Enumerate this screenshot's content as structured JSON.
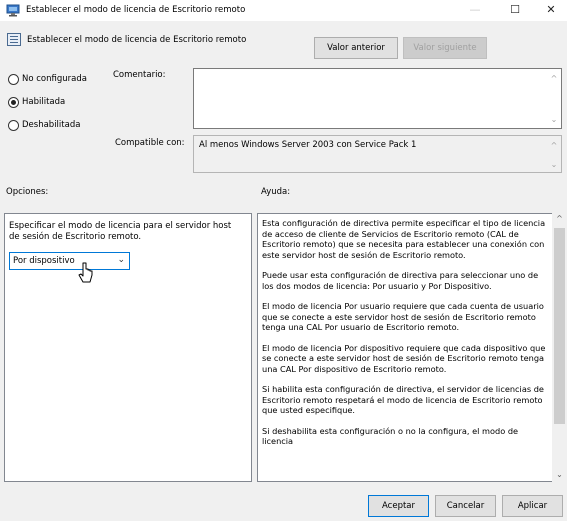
{
  "window": {
    "title": "Establecer el modo de licencia de Escritorio remoto",
    "minimize": "—",
    "maximize": "☐",
    "close": "✕"
  },
  "header": {
    "policy_title": "Establecer el modo de licencia de Escritorio remoto",
    "prev_button": "Valor anterior",
    "next_button": "Valor siguiente"
  },
  "state": {
    "options": [
      {
        "label": "No configurada",
        "checked": false
      },
      {
        "label": "Habilitada",
        "checked": true
      },
      {
        "label": "Deshabilitada",
        "checked": false
      }
    ]
  },
  "comment": {
    "label": "Comentario:",
    "value": ""
  },
  "supported": {
    "label": "Compatible con:",
    "value": "Al menos Windows Server 2003 con Service Pack 1"
  },
  "options_section": {
    "heading": "Opciones:",
    "description": "Especificar el modo de licencia para el servidor host de sesión de Escritorio remoto.",
    "combo_value": "Por dispositivo"
  },
  "help_section": {
    "heading": "Ayuda:",
    "paragraphs": [
      "Esta configuración de directiva permite especificar el tipo de licencia de acceso de cliente de Servicios de Escritorio remoto (CAL de Escritorio remoto) que se necesita para establecer una conexión con este servidor host de sesión de Escritorio remoto.",
      "Puede usar esta configuración de directiva para seleccionar uno de los dos modos de licencia: Por usuario y Por Dispositivo.",
      "El modo de licencia Por usuario requiere que cada cuenta de usuario que se conecte a este servidor host de sesión de Escritorio remoto tenga una CAL Por usuario de Escritorio remoto.",
      "El modo de licencia Por dispositivo requiere que cada dispositivo que se conecte a este servidor host de sesión de Escritorio remoto tenga una CAL Por dispositivo de Escritorio remoto.",
      "Si habilita esta configuración de directiva, el servidor de licencias de Escritorio remoto respetará el modo de licencia de Escritorio remoto que usted especifique.",
      "Si deshabilita esta configuración o no la configura, el modo de licencia"
    ]
  },
  "footer": {
    "ok": "Aceptar",
    "cancel": "Cancelar",
    "apply": "Aplicar"
  },
  "icons": {
    "app": "policy-app-icon",
    "policy": "policy-setting-icon",
    "cursor": "mouse-pointer-icon"
  }
}
